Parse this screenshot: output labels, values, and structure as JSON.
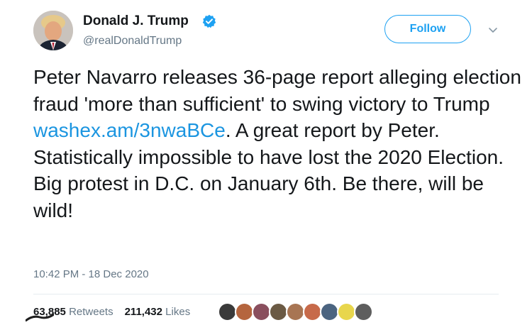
{
  "author": {
    "display_name": "Donald J. Trump",
    "handle": "@realDonaldTrump",
    "verified": true,
    "avatar_icon": "profile-photo-icon"
  },
  "header": {
    "follow_label": "Follow",
    "more_icon": "chevron-down-icon"
  },
  "tweet": {
    "text_before_link": "Peter Navarro releases 36-page report alleging election fraud 'more than sufficient' to swing victory to Trump ",
    "link_text": "washex.am/3nwaBCe",
    "text_after_link": ". A great report by Peter. Statistically impossible to have lost the 2020 Election. Big protest in D.C. on January 6th. Be there, will be wild!",
    "timestamp": "10:42 PM - 18 Dec 2020"
  },
  "stats": {
    "retweets_count": "63,885",
    "retweets_label": "Retweets",
    "likes_count": "211,432",
    "likes_label": "Likes"
  },
  "colors": {
    "accent": "#1da1f2",
    "link": "#1b95e0",
    "text": "#14171a",
    "secondary_text": "#657786",
    "divider": "#e6ecf0"
  },
  "liker_avatars": [
    {
      "icon": "liker-avatar-icon",
      "color": "#3a3a3a"
    },
    {
      "icon": "liker-avatar-icon",
      "color": "#b5653e"
    },
    {
      "icon": "liker-avatar-icon",
      "color": "#8a4f5e"
    },
    {
      "icon": "liker-avatar-icon",
      "color": "#6b5a44"
    },
    {
      "icon": "liker-avatar-icon",
      "color": "#a87553"
    },
    {
      "icon": "liker-avatar-icon",
      "color": "#c76a4a"
    },
    {
      "icon": "liker-avatar-icon",
      "color": "#4b6480"
    },
    {
      "icon": "liker-avatar-icon",
      "color": "#e8d64c"
    },
    {
      "icon": "liker-avatar-icon",
      "color": "#5e5e5e"
    }
  ]
}
